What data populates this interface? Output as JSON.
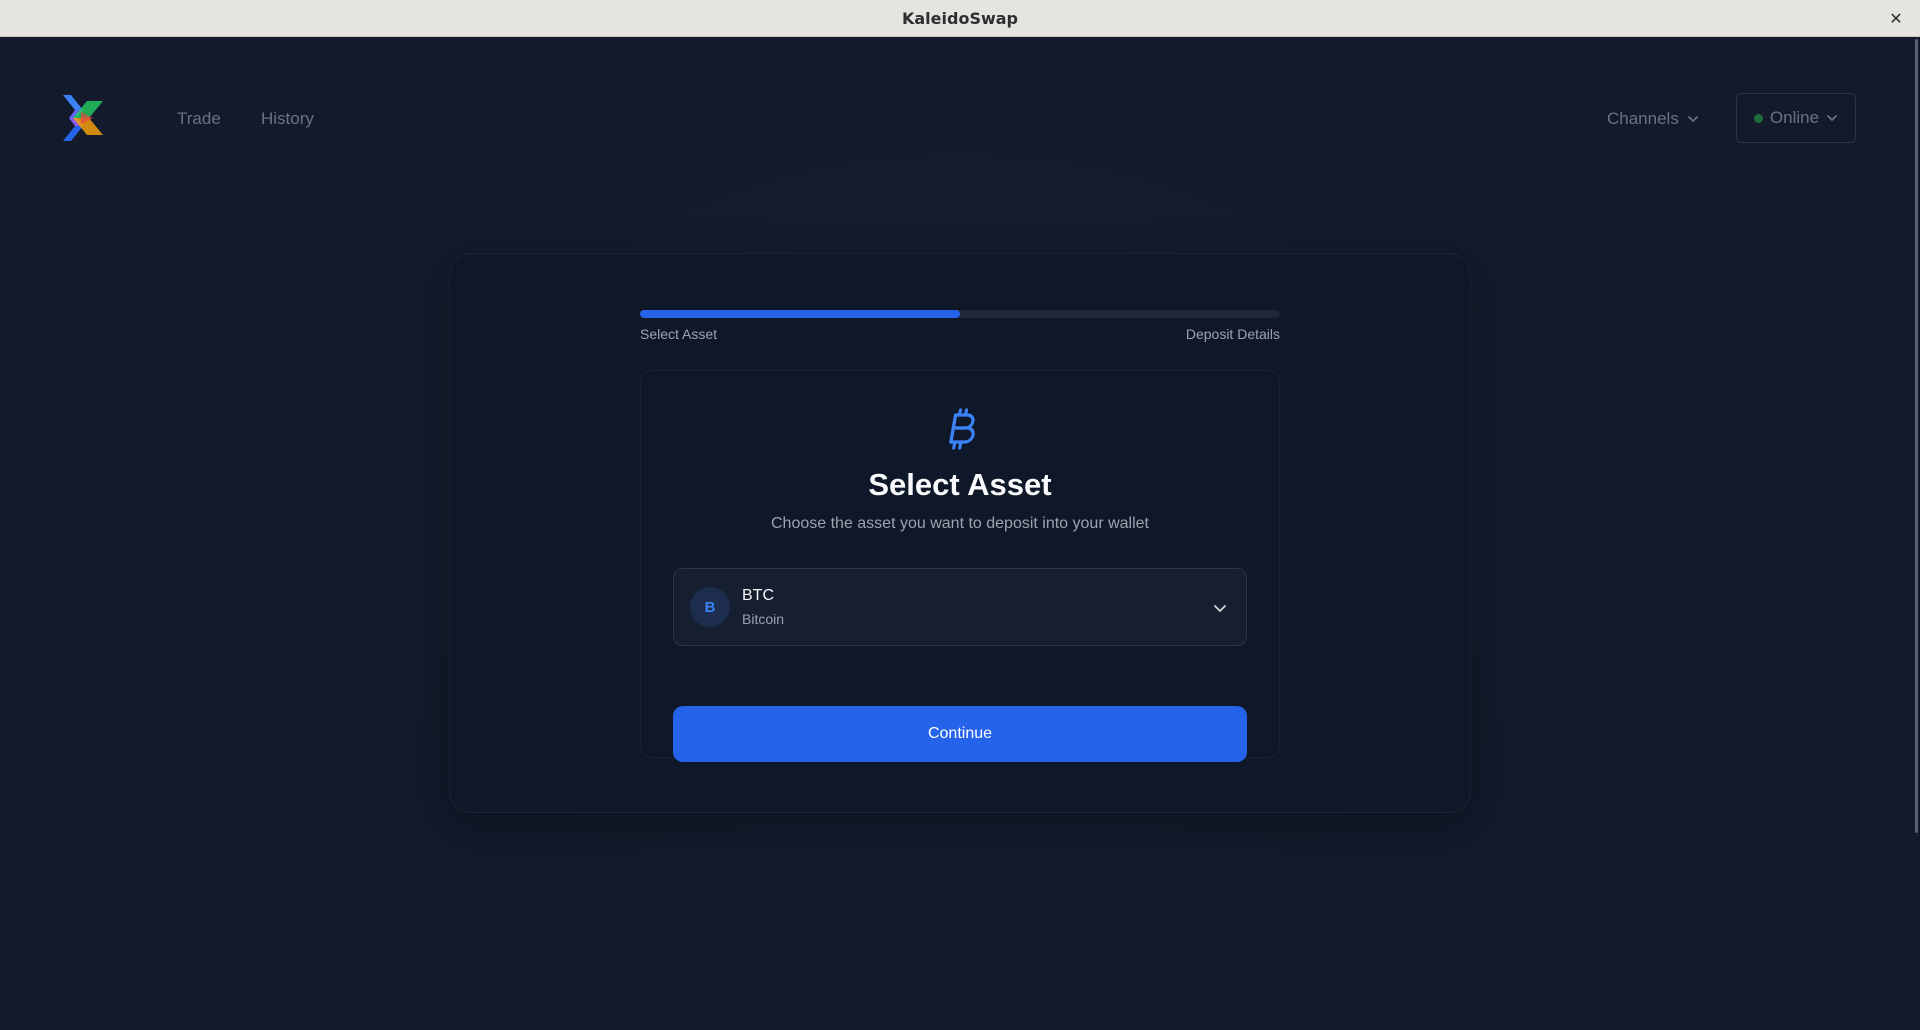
{
  "window": {
    "title": "KaleidoSwap",
    "close_glyph": "✕"
  },
  "nav": {
    "logo_icon": "kaleidoswap-logo-icon",
    "links": [
      {
        "label": "Trade"
      },
      {
        "label": "History"
      }
    ],
    "channels_label": "Channels",
    "status_label": "Online",
    "status_color": "#1f6b3f"
  },
  "stepper": {
    "progress": 0.5,
    "steps": [
      {
        "label": "Select Asset"
      },
      {
        "label": "Deposit Details"
      }
    ]
  },
  "card": {
    "icon": "bitcoin-icon",
    "title": "Select Asset",
    "subtitle": "Choose the asset you want to deposit into your wallet",
    "asset": {
      "avatar_letter": "B",
      "ticker": "BTC",
      "name": "Bitcoin"
    },
    "continue_label": "Continue"
  },
  "colors": {
    "accent": "#2563eb",
    "background": "#131b2c"
  }
}
